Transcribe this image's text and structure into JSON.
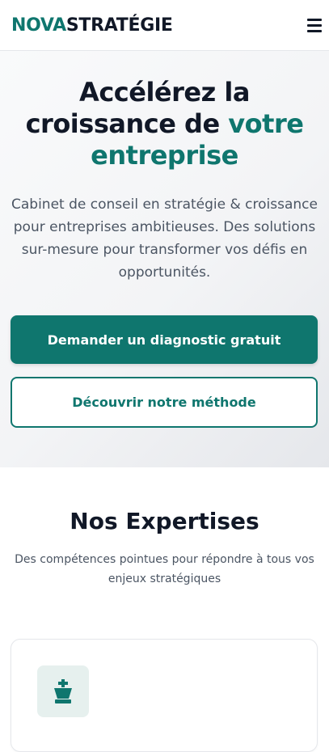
{
  "header": {
    "logo_part1": "NOVA",
    "logo_part2": "STRATÉGIE",
    "menu_icon": "hamburger-menu-icon"
  },
  "hero": {
    "title_line1": "Accélérez la",
    "title_line2_start": "croissance de ",
    "title_accent": "votre entreprise",
    "description": "Cabinet de conseil en stratégie & croissance pour entreprises ambitieuses. Des solutions sur-mesure pour transformer vos défis en opportunités.",
    "primary_button": "Demander un diagnostic gratuit",
    "secondary_button": "Découvrir notre méthode"
  },
  "expertises": {
    "title": "Nos Expertises",
    "subtitle": "Des compétences pointues pour répondre à tous vos enjeux stratégiques",
    "card_icon": "chess-king-icon"
  },
  "colors": {
    "accent": "#0f766e",
    "text": "#111827",
    "muted": "#4b5563"
  }
}
